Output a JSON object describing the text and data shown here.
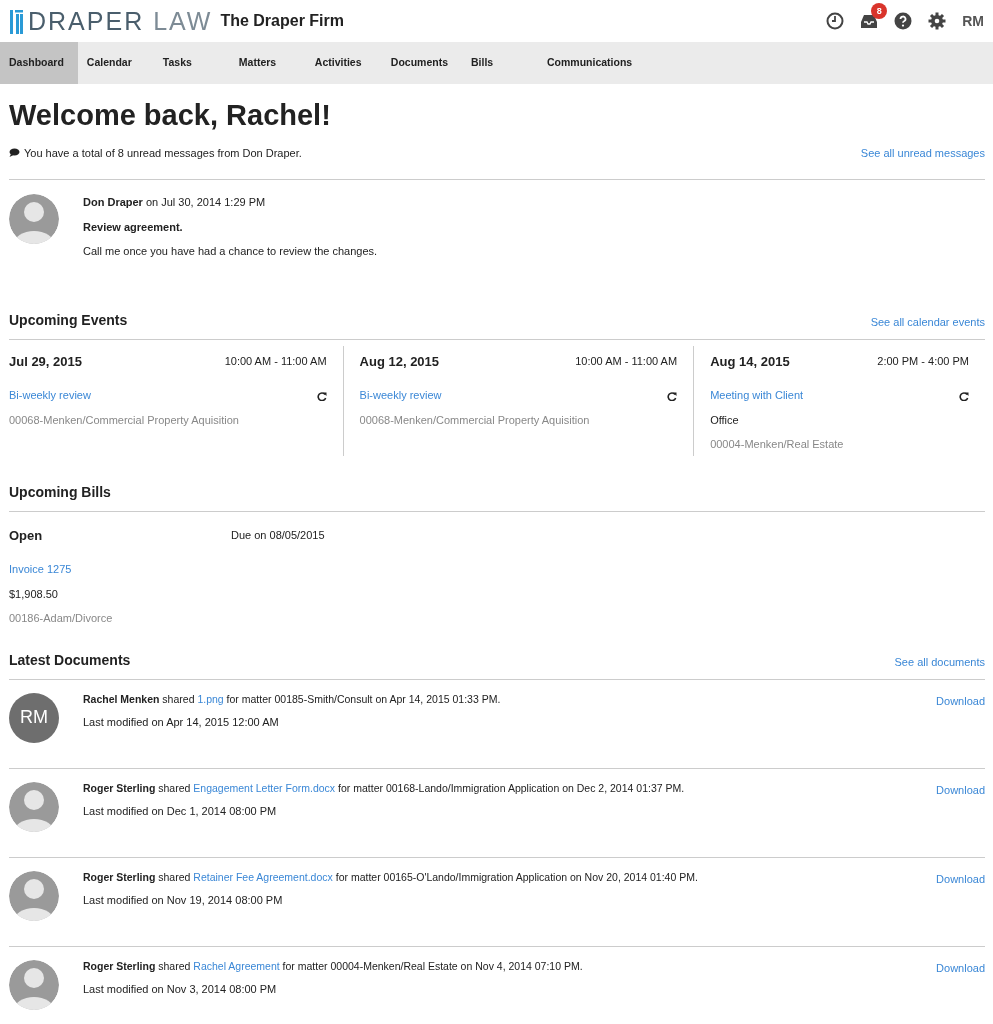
{
  "header": {
    "logo": {
      "brand": "DRAPER",
      "suffix": "LAW"
    },
    "firm": "The Draper Firm",
    "notification_count": "8",
    "user_initials": "RM"
  },
  "tabs": [
    {
      "label": "Dashboard",
      "selected": true
    },
    {
      "label": "Calendar",
      "selected": false
    },
    {
      "label": "Tasks",
      "selected": false
    },
    {
      "label": "Matters",
      "selected": false
    },
    {
      "label": "Activities",
      "selected": false
    },
    {
      "label": "Documents",
      "selected": false
    },
    {
      "label": "Bills",
      "selected": false
    },
    {
      "label": "Communications",
      "selected": false
    }
  ],
  "welcome": "Welcome back, Rachel!",
  "messages": {
    "summary": "You have a total of 8 unread messages from Don Draper.",
    "link": "See all unread messages",
    "items": [
      {
        "author": "Don Draper",
        "date": "on Jul 30, 2014 1:29 PM",
        "subject": "Review agreement.",
        "body": "Call me once you have had a chance to review the changes."
      }
    ]
  },
  "events": {
    "title": "Upcoming Events",
    "link": "See all calendar events",
    "items": [
      {
        "date": "Jul 29, 2015",
        "time": "10:00 AM - 11:00 AM",
        "name": "Bi-weekly review",
        "recurring": true,
        "matter": "00068-Menken/Commercial Property Aquisition"
      },
      {
        "date": "Aug 12, 2015",
        "time": "10:00 AM - 11:00 AM",
        "name": "Bi-weekly review",
        "recurring": true,
        "matter": "00068-Menken/Commercial Property Aquisition"
      },
      {
        "date": "Aug 14, 2015",
        "time": "2:00 PM - 4:00 PM",
        "name": "Meeting with Client",
        "recurring": true,
        "location": "Office",
        "matter": "00004-Menken/Real Estate"
      }
    ]
  },
  "bills": {
    "title": "Upcoming Bills",
    "items": [
      {
        "status": "Open",
        "due": "Due on 08/05/2015",
        "invoice": "Invoice 1275",
        "amount": "$1,908.50",
        "matter": "00186-Adam/Divorce"
      }
    ]
  },
  "documents": {
    "title": "Latest Documents",
    "link": "See all documents",
    "items": [
      {
        "avatar": {
          "kind": "initials",
          "initials": "RM"
        },
        "user": "Rachel Menken",
        "verb": " shared ",
        "file": "1.png",
        "rest": " for matter 00185-Smith/Consult on Apr 14, 2015 01:33 PM.",
        "modified": "Last modified on Apr 14, 2015 12:00 AM",
        "action": "Download"
      },
      {
        "avatar": {
          "kind": "silhouette"
        },
        "user": "Roger Sterling",
        "verb": " shared ",
        "file": "Engagement Letter Form.docx",
        "rest": " for matter 00168-Lando/Immigration Application on Dec 2, 2014 01:37 PM.",
        "modified": "Last modified on Dec 1, 2014 08:00 PM",
        "action": "Download"
      },
      {
        "avatar": {
          "kind": "silhouette"
        },
        "user": "Roger Sterling",
        "verb": " shared ",
        "file": "Retainer Fee Agreement.docx",
        "rest": " for matter 00165-O'Lando/Immigration Application on Nov 20, 2014 01:40 PM.",
        "modified": "Last modified on Nov 19, 2014 08:00 PM",
        "action": "Download"
      },
      {
        "avatar": {
          "kind": "silhouette"
        },
        "user": "Roger Sterling",
        "verb": " shared ",
        "file": "Rachel Agreement",
        "rest": " for matter 00004-Menken/Real Estate on Nov 4, 2014 07:10 PM.",
        "modified": "Last modified on Nov 3, 2014 08:00 PM",
        "action": "Download"
      }
    ]
  }
}
